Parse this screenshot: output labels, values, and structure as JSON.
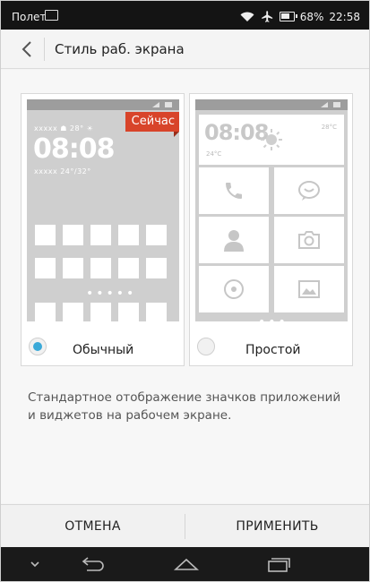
{
  "status_bar": {
    "carrier": "Полет",
    "battery": "68%",
    "time": "22:58",
    "icons": [
      "image-icon",
      "wifi-icon",
      "airplane-icon",
      "battery-icon"
    ]
  },
  "header": {
    "title": "Стиль раб. экрана",
    "back_icon": "chevron-left-icon"
  },
  "options": [
    {
      "label": "Обычный",
      "selected": true,
      "badge": "Сейчас",
      "preview": {
        "weather": "xxxxx ☗ 28° ☀",
        "clock": "08:08",
        "date": "xxxxx 24°/32°"
      }
    },
    {
      "label": "Простой",
      "selected": false,
      "preview": {
        "clock": "08:08",
        "small": "24°C",
        "temp": "28°C"
      }
    }
  ],
  "description": "Стандартное отображение значков приложений и виджетов на рабочем экране.",
  "actions": {
    "cancel": "ОТМЕНА",
    "apply": "ПРИМЕНИТЬ"
  },
  "colors": {
    "accent": "#3aa9d8",
    "badge": "#d8442a",
    "status_bar": "#141414"
  }
}
